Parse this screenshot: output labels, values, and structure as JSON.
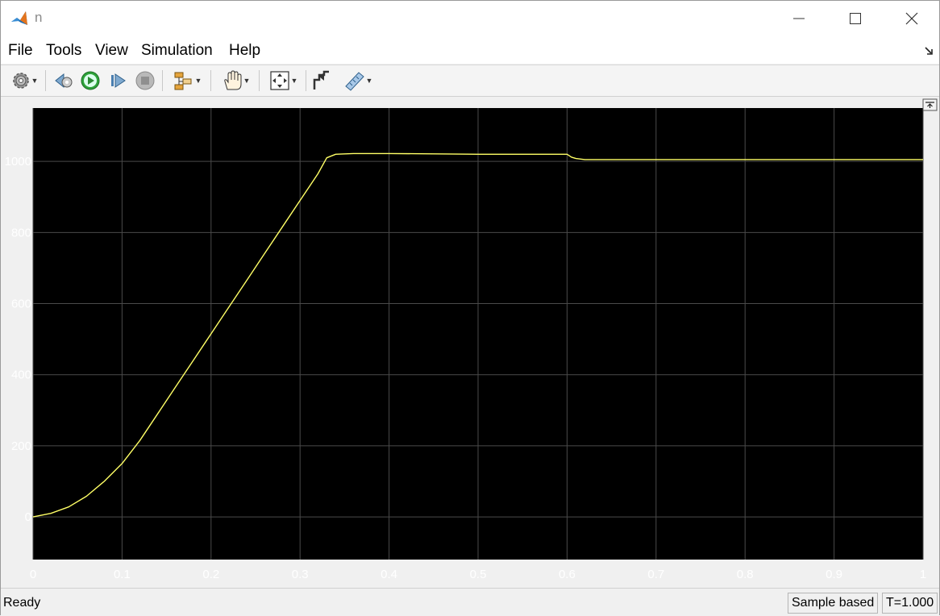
{
  "window": {
    "title": "n",
    "controls": {
      "minimize": "minimize",
      "maximize": "maximize",
      "close": "close"
    }
  },
  "menu": {
    "items": [
      "File",
      "Tools",
      "View",
      "Simulation",
      "Help"
    ],
    "expand_icon": "expand-arrow-icon"
  },
  "toolbar": {
    "icons": [
      "settings-gear-icon",
      "step-back-icon",
      "run-icon",
      "step-forward-icon",
      "stop-icon",
      "signal-hierarchy-icon",
      "pan-hand-icon",
      "zoom-fit-icon",
      "highlight-block-icon",
      "measurement-ruler-icon"
    ]
  },
  "plot": {
    "background": "#000000",
    "grid_color": "#4a4a4a",
    "line_color": "#ffff66",
    "axis_text_color": "#ffffff",
    "undock_icon": "undock-icon"
  },
  "chart_data": {
    "type": "line",
    "title": "",
    "xlabel": "",
    "ylabel": "",
    "xlim": [
      0,
      1
    ],
    "ylim": [
      -120,
      1150
    ],
    "grid": true,
    "xticks": [
      0,
      0.1,
      0.2,
      0.3,
      0.4,
      0.5,
      0.6,
      0.7,
      0.8,
      0.9,
      1
    ],
    "xtick_labels": [
      "0",
      "0.1",
      "0.2",
      "0.3",
      "0.4",
      "0.5",
      "0.6",
      "0.7",
      "0.8",
      "0.9",
      "1"
    ],
    "yticks": [
      0,
      200,
      400,
      600,
      800,
      1000
    ],
    "ytick_labels": [
      "0",
      "200",
      "400",
      "600",
      "800",
      "1000"
    ],
    "series": [
      {
        "x": [
          0,
          0.02,
          0.04,
          0.06,
          0.08,
          0.1,
          0.12,
          0.14,
          0.16,
          0.18,
          0.2,
          0.22,
          0.24,
          0.26,
          0.28,
          0.3,
          0.32,
          0.33,
          0.34,
          0.36,
          0.4,
          0.5,
          0.6,
          0.605,
          0.61,
          0.62,
          0.65,
          0.8,
          1.0
        ],
        "y": [
          0,
          10,
          28,
          58,
          100,
          150,
          215,
          290,
          365,
          440,
          515,
          590,
          665,
          740,
          815,
          890,
          965,
          1010,
          1020,
          1022,
          1022,
          1020,
          1020,
          1012,
          1008,
          1005,
          1005,
          1005,
          1005
        ]
      }
    ]
  },
  "status": {
    "text": "Ready",
    "mode": "Sample based",
    "time": "T=1.000"
  }
}
